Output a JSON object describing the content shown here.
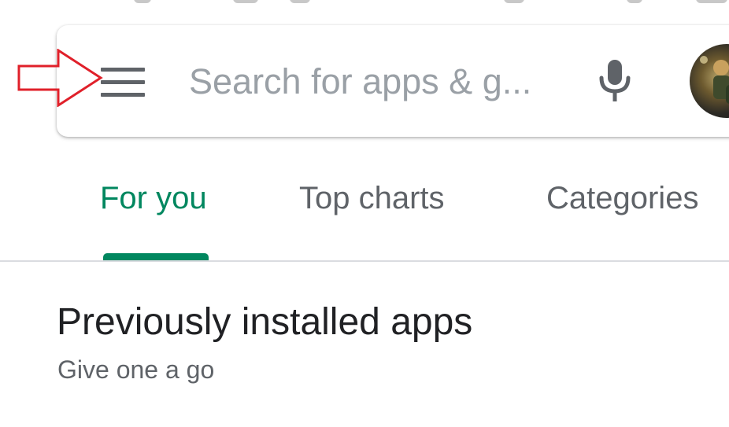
{
  "search": {
    "placeholder": "Search for apps & g..."
  },
  "icons": {
    "menu": "hamburger-menu-icon",
    "mic": "microphone-icon",
    "avatar": "user-avatar",
    "annotation": "red-outline-arrow-icon"
  },
  "tabs": [
    {
      "label": "For you",
      "active": true
    },
    {
      "label": "Top charts",
      "active": false
    },
    {
      "label": "Categories",
      "active": false
    }
  ],
  "section": {
    "title": "Previously installed apps",
    "subtitle": "Give one a go"
  },
  "colors": {
    "accent": "#01875f",
    "icon_gray": "#5f6368",
    "placeholder_gray": "#9aa0a6",
    "annotation_red": "#e0202a",
    "text_dark": "#202124"
  }
}
